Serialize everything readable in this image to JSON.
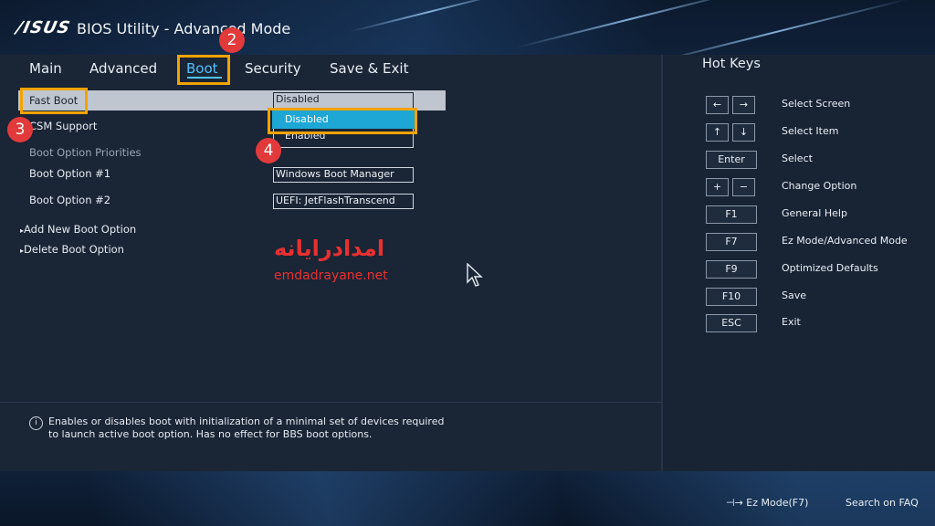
{
  "header": {
    "logo": "/ISUS",
    "title": "BIOS Utility - Advanced Mode"
  },
  "tabs": [
    {
      "label": "Main"
    },
    {
      "label": "Advanced"
    },
    {
      "label": "Boot"
    },
    {
      "label": "Security"
    },
    {
      "label": "Save & Exit"
    }
  ],
  "annotations": {
    "step2": "2",
    "step3": "3",
    "step4": "4"
  },
  "boot": {
    "fast_boot_label": "Fast Boot",
    "fast_boot_value": "Disabled",
    "csm_label": "CSM Support",
    "dropdown_options": [
      "Disabled",
      "Enabled"
    ],
    "priorities_header": "Boot Option Priorities",
    "option1_label": "Boot Option #1",
    "option1_value": "Windows Boot Manager",
    "option2_label": "Boot Option #2",
    "option2_value": "UEFI: JetFlashTranscend",
    "add_new": "Add New Boot Option",
    "delete": "Delete Boot Option"
  },
  "watermark": {
    "fa": "امدادرایانه",
    "en": "emdadrayane.net"
  },
  "description": "Enables or disables boot with initialization of a minimal set of devices required to launch active boot option. Has no effect for BBS boot options.",
  "hotkeys": {
    "title": "Hot Keys",
    "items": [
      {
        "keys": [
          "←",
          "→"
        ],
        "label": "Select Screen"
      },
      {
        "keys": [
          "↑",
          "↓"
        ],
        "label": "Select Item"
      },
      {
        "keys": [
          "Enter"
        ],
        "label": "Select"
      },
      {
        "keys": [
          "+",
          "−"
        ],
        "label": "Change Option"
      },
      {
        "keys": [
          "F1"
        ],
        "label": "General Help"
      },
      {
        "keys": [
          "F7"
        ],
        "label": "Ez Mode/Advanced Mode"
      },
      {
        "keys": [
          "F9"
        ],
        "label": "Optimized Defaults"
      },
      {
        "keys": [
          "F10"
        ],
        "label": "Save"
      },
      {
        "keys": [
          "ESC"
        ],
        "label": "Exit"
      }
    ]
  },
  "footer": {
    "ez_mode": "⊣→ Ez Mode(F7)",
    "search": "Search on FAQ"
  },
  "colors": {
    "accent": "#4fc3ff",
    "highlight": "#f3a300",
    "badge": "#e23a3a",
    "selected_option": "#1ea7d4"
  }
}
